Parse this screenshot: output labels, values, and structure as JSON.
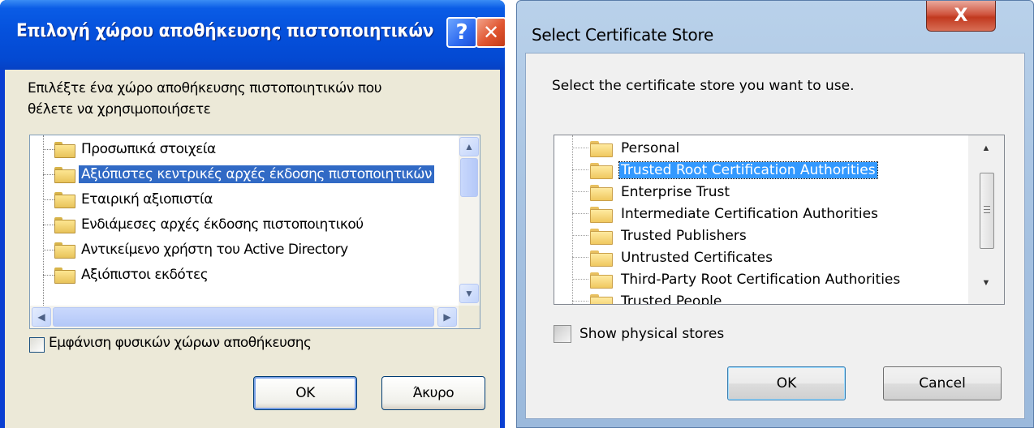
{
  "xp_dialog": {
    "title": "Επιλογή χώρου αποθήκευσης πιστοποιητικών",
    "help_label": "?",
    "close_label": "✕",
    "instruction_line1": "Επιλέξτε ένα χώρο αποθήκευσης πιστοποιητικών που",
    "instruction_line2": "θέλετε να χρησιμοποιήσετε",
    "stores": [
      {
        "label": "Προσωπικά στοιχεία",
        "selected": false
      },
      {
        "label": "Αξιόπιστες κεντρικές αρχές έκδοσης πιστοποιητικών",
        "selected": true
      },
      {
        "label": "Εταιρική αξιοπιστία",
        "selected": false
      },
      {
        "label": "Ενδιάμεσες αρχές έκδοσης πιστοποιητικού",
        "selected": false
      },
      {
        "label": "Αντικείμενο χρήστη του Active Directory",
        "selected": false
      },
      {
        "label": "Αξιόπιστοι εκδότες",
        "selected": false
      }
    ],
    "show_physical_label": "Εμφάνιση φυσικών χώρων αποθήκευσης",
    "show_physical_checked": false,
    "ok_label": "OK",
    "cancel_label": "Άκυρο"
  },
  "w7_dialog": {
    "title": "Select Certificate Store",
    "close_label": "X",
    "instruction": "Select the certificate store you want to use.",
    "stores": [
      {
        "label": "Personal",
        "selected": false
      },
      {
        "label": "Trusted Root Certification Authorities",
        "selected": true
      },
      {
        "label": "Enterprise Trust",
        "selected": false
      },
      {
        "label": "Intermediate Certification Authorities",
        "selected": false
      },
      {
        "label": "Trusted Publishers",
        "selected": false
      },
      {
        "label": "Untrusted Certificates",
        "selected": false
      },
      {
        "label": "Third-Party Root Certification Authorities",
        "selected": false
      },
      {
        "label": "Trusted People",
        "selected": false
      }
    ],
    "show_physical_label": "Show physical stores",
    "show_physical_checked": false,
    "ok_label": "OK",
    "cancel_label": "Cancel"
  },
  "colors": {
    "xp_selection": "#316ac5",
    "w7_selection": "#3399ff",
    "xp_titlebar": "#0551dc"
  }
}
